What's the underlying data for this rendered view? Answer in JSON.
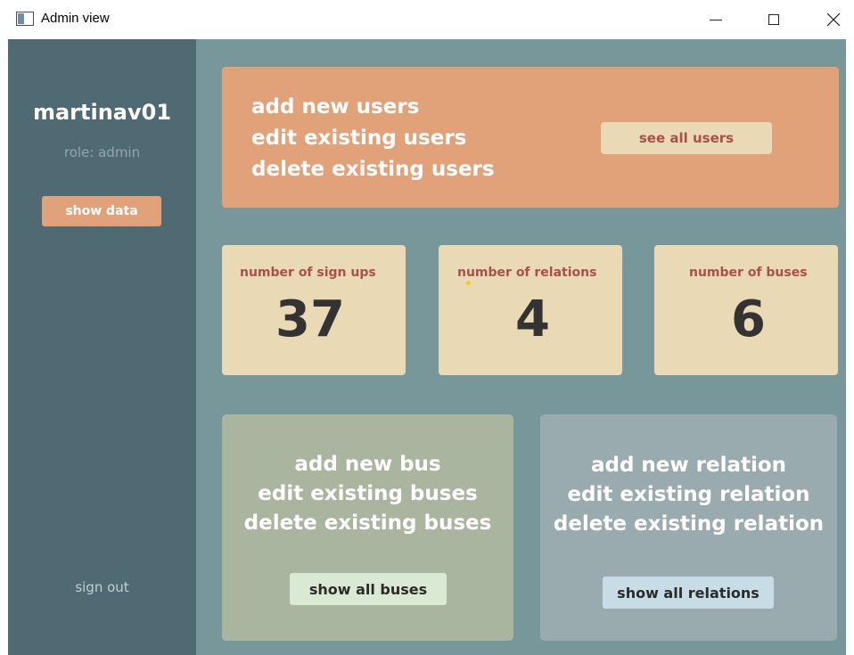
{
  "window": {
    "title": "Admin view"
  },
  "sidebar": {
    "username": "martinav01",
    "role": "role: admin",
    "show_data_label": "show data",
    "sign_out_label": "sign out"
  },
  "users_panel": {
    "lines": [
      "add new users",
      "edit existing users",
      "delete existing users"
    ],
    "button_label": "see all users"
  },
  "stats": [
    {
      "label": "number of sign ups",
      "value": "37"
    },
    {
      "label": "number of relations",
      "value": "4"
    },
    {
      "label": "number of buses",
      "value": "6"
    }
  ],
  "bus_panel": {
    "lines": [
      "add new bus",
      "edit existing buses",
      "delete existing buses"
    ],
    "button_label": "show all buses"
  },
  "relation_panel": {
    "lines": [
      "add new relation",
      "edit existing relation",
      "delete existing relation"
    ],
    "button_label": "show all relations"
  },
  "colors": {
    "background": "#78979b",
    "sidebar": "#506a74",
    "accent_orange": "#e1a27a",
    "card_beige": "#e9dab5",
    "label_red": "#a9504a",
    "bus_green": "#a9b59f",
    "relation_blue": "#9aabb0"
  },
  "icons": {
    "app": "app-window-icon",
    "minimize": "minimize-icon",
    "maximize": "maximize-icon",
    "close": "close-icon"
  }
}
